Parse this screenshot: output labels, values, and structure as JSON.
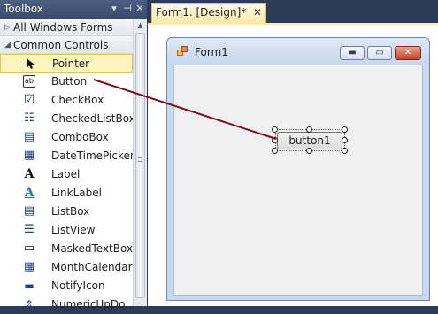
{
  "toolbox": {
    "title": "Toolbox",
    "header_buttons": {
      "dropdown": "▾",
      "pin": "⊣",
      "close": "✕"
    },
    "groups": [
      {
        "label": "All Windows Forms",
        "expanded": false,
        "arrow": "▷"
      },
      {
        "label": "Common Controls",
        "expanded": true,
        "arrow": "◢"
      }
    ],
    "items": [
      {
        "label": "Pointer",
        "icon": "pointer-arrow-icon",
        "glyph": "➤",
        "selected": true
      },
      {
        "label": "Button",
        "icon": "button-icon",
        "glyph": "ab",
        "selected": false
      },
      {
        "label": "CheckBox",
        "icon": "checkbox-icon",
        "glyph": "☑",
        "selected": false
      },
      {
        "label": "CheckedListBox",
        "icon": "checked-list-box-icon",
        "glyph": "☷",
        "selected": false
      },
      {
        "label": "ComboBox",
        "icon": "combobox-icon",
        "glyph": "▤",
        "selected": false
      },
      {
        "label": "DateTimePicker",
        "icon": "date-time-picker-icon",
        "glyph": "▦",
        "selected": false
      },
      {
        "label": "Label",
        "icon": "label-icon",
        "glyph": "A",
        "selected": false
      },
      {
        "label": "LinkLabel",
        "icon": "link-label-icon",
        "glyph": "A",
        "selected": false
      },
      {
        "label": "ListBox",
        "icon": "listbox-icon",
        "glyph": "▤",
        "selected": false
      },
      {
        "label": "ListView",
        "icon": "listview-icon",
        "glyph": "☰",
        "selected": false
      },
      {
        "label": "MaskedTextBox",
        "icon": "masked-textbox-icon",
        "glyph": "▭",
        "selected": false
      },
      {
        "label": "MonthCalendar",
        "icon": "month-calendar-icon",
        "glyph": "▦",
        "selected": false
      },
      {
        "label": "NotifyIcon",
        "icon": "notify-icon",
        "glyph": "▬",
        "selected": false
      },
      {
        "label": "NumericUpDo...",
        "icon": "numeric-updown-icon",
        "glyph": "⇕",
        "selected": false
      }
    ]
  },
  "document": {
    "tab_label": "Form1.   [Design]*",
    "tab_close": "✕"
  },
  "form": {
    "title": "Form1",
    "minimize": "▬",
    "maximize": "▭",
    "close": "✕",
    "button_text": "button1"
  },
  "colors": {
    "ide_frame": "#2b3b58",
    "selected_item_bg": "#fdf4bf",
    "drag_line": "#7b0f1c",
    "form_border": "#6f87ad"
  }
}
